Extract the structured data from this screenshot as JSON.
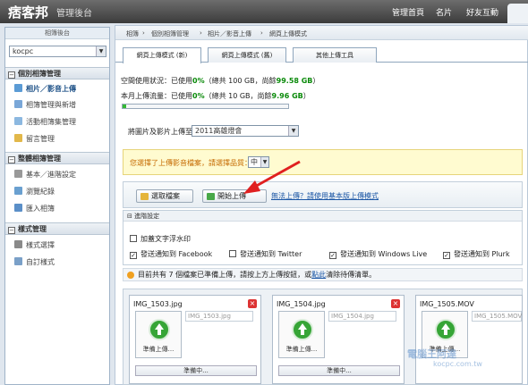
{
  "app": {
    "logo": "痞客邦",
    "subtitle": "管理後台"
  },
  "topnav": [
    "管理首頁",
    "名片",
    "好友互動"
  ],
  "sidebar": {
    "header": "相簿後台",
    "account": "kocpc",
    "sections": [
      {
        "label": "個別相簿管理",
        "items": [
          "相片／影音上傳",
          "相簿管理與新增",
          "活動相簿集管理",
          "留言管理"
        ]
      },
      {
        "label": "整體相簿管理",
        "items": [
          "基本／進階設定",
          "瀏覽紀錄",
          "匯入相簿"
        ]
      },
      {
        "label": "樣式管理",
        "items": [
          "樣式選擇",
          "自訂樣式"
        ]
      }
    ]
  },
  "breadcrumb": [
    "相簿",
    "個別相簿管理",
    "相片／影音上傳",
    "網頁上傳模式"
  ],
  "tabs": [
    "網頁上傳模式 (新)",
    "網頁上傳模式 (舊)",
    "其他上傳工具"
  ],
  "quota": {
    "space_label": "空間使用狀況：已使用",
    "space_pct": "0%",
    "space_total": "（總共 100 GB，尚餘",
    "space_remain": "99.58 GB",
    "space_close": "）",
    "month_label": "本月上傳流量：已使用",
    "month_pct": "0%",
    "month_total": "（總共 10 GB，尚餘",
    "month_remain": "9.96 GB",
    "month_close": "）",
    "month_fraction": 0.004
  },
  "upload_to_label": "將圖片及影片上傳至",
  "upload_to_value": "2011高雄燈會",
  "notice": {
    "text": "您選擇了上傳影音檔案，請選擇品質：",
    "quality": "中"
  },
  "buttons": {
    "select": "選取檔案",
    "start": "開始上傳"
  },
  "help_link": "無法上傳？請使用基本版上傳模式",
  "advanced": {
    "header": "進階設定",
    "watermark": "加蓋文字浮水印",
    "notify": [
      {
        "label": "發送通知到 Facebook",
        "checked": true
      },
      {
        "label": "發送通知到 Twitter",
        "checked": false
      },
      {
        "label": "發送通知到 Windows Live",
        "checked": true
      },
      {
        "label": "發送通知到 Plurk",
        "checked": true
      }
    ]
  },
  "info": {
    "pre": "目前共有 7 個檔案已準備上傳，請按上方上傳按鈕，或",
    "link": "點此",
    "post": "清除待傳清單。"
  },
  "files": [
    {
      "name": "IMG_1503.jpg",
      "caption": "IMG_1503.jpg",
      "status": "準備上傳...",
      "progress": "準備中..."
    },
    {
      "name": "IMG_1504.jpg",
      "caption": "IMG_1504.jpg",
      "status": "準備上傳...",
      "progress": "準備中..."
    },
    {
      "name": "IMG_1505.MOV",
      "caption": "IMG_1505.MOV",
      "status": "準備上傳...",
      "progress": "準備中..."
    }
  ],
  "watermark": {
    "main": "電腦王阿達",
    "url": "kocpc.com.tw"
  },
  "colors": {
    "topbar": "#4a4a4a",
    "accent": "#1b56a5",
    "green": "#0a8a0a",
    "notice_text": "#c56a00",
    "arrow": "#e02020"
  }
}
